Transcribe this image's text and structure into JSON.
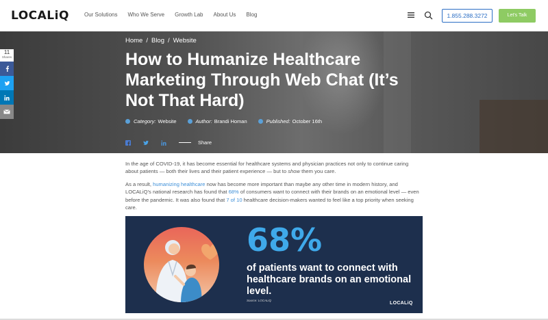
{
  "header": {
    "logo": "LOCALiQ",
    "nav": [
      "Our Solutions",
      "Who We Serve",
      "Growth Lab",
      "About Us",
      "Blog"
    ],
    "phone": "1.855.288.3272",
    "cta": "Let's Talk",
    "icons": [
      "menu-icon",
      "search-icon"
    ]
  },
  "breadcrumb": [
    "Home",
    "/",
    "Blog",
    "/",
    "Website"
  ],
  "hero": {
    "title": "How to Humanize Healthcare Marketing Through Web Chat (It’s Not That Hard)",
    "meta": {
      "category_label": "Category:",
      "category": "Website",
      "author_label": "Author:",
      "author": "Brandi Homan",
      "published_label": "Published:",
      "published": "October 16th"
    },
    "share_label": "Share"
  },
  "side_share": {
    "count": "11",
    "count_label": "Shares"
  },
  "article": {
    "p1_a": "In the age of COVID-19, it has become essential for healthcare systems and physician practices not only to continue caring about patients — both their lives and their patient experience — but to ",
    "p1_em": "show",
    "p1_b": " them you care.",
    "p2_a": "As a result, ",
    "p2_link1": "humanizing healthcare",
    "p2_b": " now has become more important than maybe any other time in modern history, and LOCALiQ’s national research has found that ",
    "p2_link2": "68%",
    "p2_c": " of consumers want to connect with their brands on an emotional level — even before the pandemic. It was also found that ",
    "p2_link3": "7 of 10",
    "p2_d": " healthcare decision-makers wanted to feel like a top priority when seeking care."
  },
  "infographic": {
    "percent": "68%",
    "text": "of patients want to connect with healthcare brands on an emotional level.",
    "source_label": "Source:",
    "source": "LOCALiQ",
    "logo": "LOCALiQ"
  },
  "colors": {
    "accent_blue": "#2b6ec4",
    "cta_green": "#8ecb63",
    "banner_navy": "#1d2f4d",
    "banner_blue": "#3fa9ea",
    "link": "#3d8fd8"
  }
}
